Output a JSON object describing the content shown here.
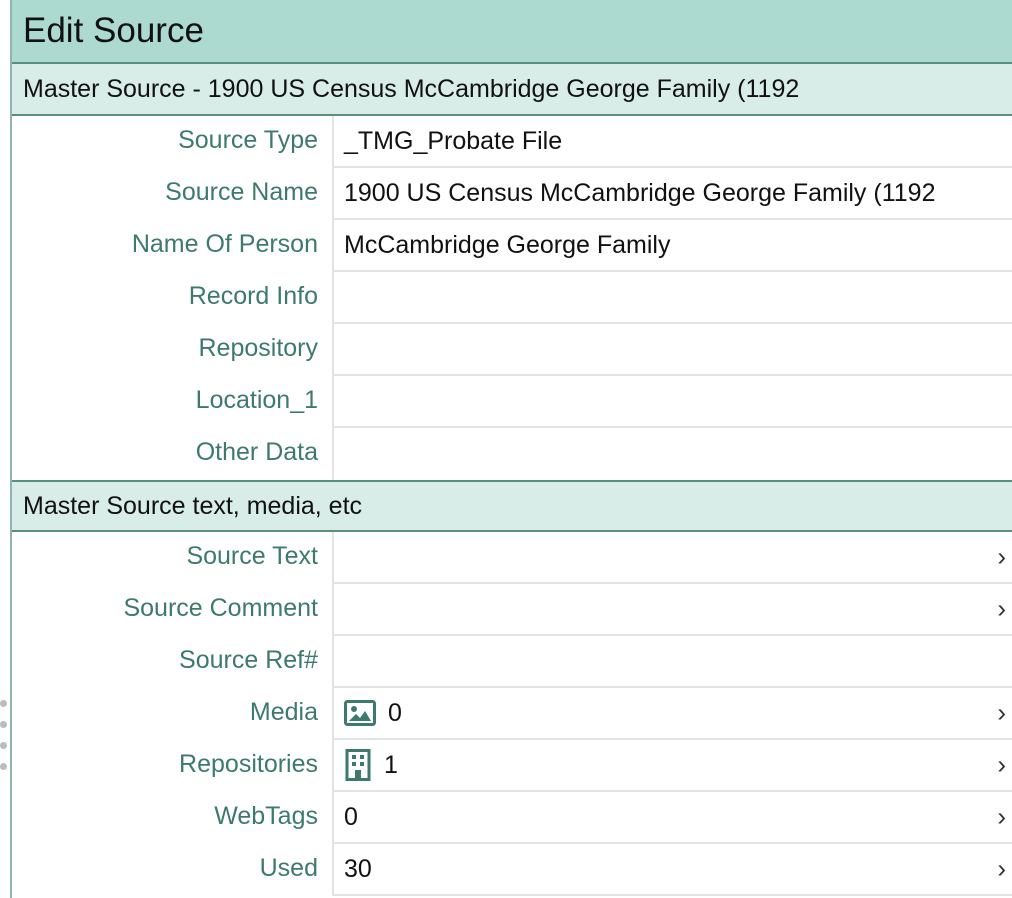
{
  "window": {
    "title": "Edit Source"
  },
  "section1": {
    "title": "Master Source - 1900 US Census McCambridge George Family (1192"
  },
  "fields": [
    {
      "label": "Source Type",
      "value": "_TMG_Probate File"
    },
    {
      "label": "Source Name",
      "value": "1900 US Census McCambridge George Family (1192"
    },
    {
      "label": "Name Of Person",
      "value": "McCambridge George Family"
    },
    {
      "label": "Record Info",
      "value": ""
    },
    {
      "label": "Repository",
      "value": ""
    },
    {
      "label": "Location_1",
      "value": ""
    },
    {
      "label": "Other Data",
      "value": ""
    }
  ],
  "section2": {
    "title": "Master Source text, media, etc"
  },
  "fields2": [
    {
      "label": "Source Text",
      "value": "",
      "chevron": true
    },
    {
      "label": "Source Comment",
      "value": "",
      "chevron": true
    },
    {
      "label": "Source Ref#",
      "value": "",
      "chevron": false
    },
    {
      "label": "Media",
      "value": "0",
      "icon": "image-icon",
      "chevron": true
    },
    {
      "label": "Repositories",
      "value": "1",
      "icon": "building-icon",
      "chevron": true
    },
    {
      "label": "WebTags",
      "value": "0",
      "chevron": true
    },
    {
      "label": "Used",
      "value": "30",
      "chevron": true
    }
  ],
  "chevron_glyph": "›",
  "colors": {
    "titlebar": "#acd9d0",
    "section": "#d8ece8",
    "label": "#3d7a6d",
    "border": "#5a8f80"
  }
}
